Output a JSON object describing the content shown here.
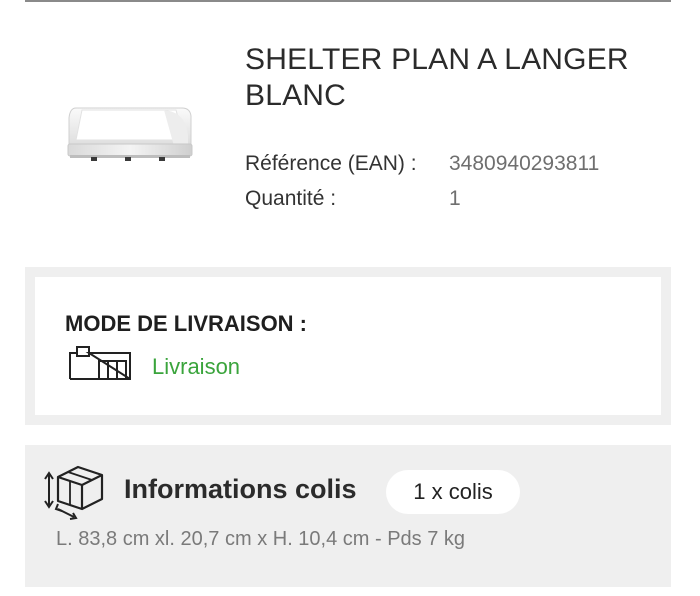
{
  "product": {
    "title_line1": "SHELTER PLAN A LANGER",
    "title_line2": "BLANC",
    "reference_label": "Référence (EAN) :",
    "reference_value": "3480940293811",
    "quantity_label": "Quantité :",
    "quantity_value": "1",
    "image_icon": "changing-table-image"
  },
  "delivery": {
    "title": "MODE DE LIVRAISON :",
    "mode": "Livraison",
    "icon": "delivery-truck-icon",
    "mode_color": "#3aa43c"
  },
  "parcel": {
    "title": "Informations colis",
    "count_badge": "1 x colis",
    "dimensions": "L. 83,8 cm xl. 20,7 cm x H. 10,4 cm - Pds 7 kg",
    "icon": "package-dimensions-icon"
  },
  "colors": {
    "panel_background": "#efefef",
    "text_primary": "#2b2b2b",
    "text_secondary": "#6f6f6f"
  }
}
